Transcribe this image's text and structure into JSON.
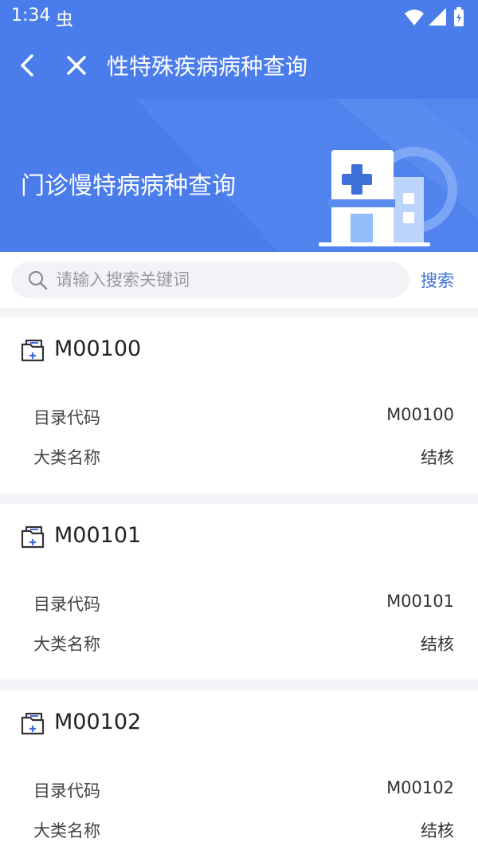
{
  "status_bar": {
    "time": "1:34",
    "bug_glyph": "虫",
    "icons": [
      "wifi-icon",
      "signal-icon",
      "battery-icon"
    ]
  },
  "appbar": {
    "title": "性特殊疾病病种查询"
  },
  "banner": {
    "title": "门诊慢特病病种查询"
  },
  "search": {
    "placeholder": "请输入搜索关键词",
    "value": "",
    "button_label": "搜索"
  },
  "records": [
    {
      "title": "M00100",
      "fields": [
        {
          "label": "目录代码",
          "value": "M00100"
        },
        {
          "label": "大类名称",
          "value": "结核"
        }
      ]
    },
    {
      "title": "M00101",
      "fields": [
        {
          "label": "目录代码",
          "value": "M00101"
        },
        {
          "label": "大类名称",
          "value": "结核"
        }
      ]
    },
    {
      "title": "M00102",
      "fields": [
        {
          "label": "目录代码",
          "value": "M00102"
        },
        {
          "label": "大类名称",
          "value": "结核"
        }
      ]
    }
  ],
  "colors": {
    "header_blue": "#4a7cec",
    "accent_blue": "#3b6fe0",
    "page_background": "#f3f4f7"
  }
}
